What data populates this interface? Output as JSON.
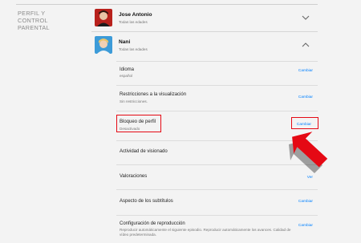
{
  "section_title": "PERFIL Y CONTROL PARENTAL",
  "profiles": [
    {
      "name": "Jose Antonio",
      "maturity": "Todas las edades",
      "expanded": false
    },
    {
      "name": "Nani",
      "maturity": "Todas las edades",
      "expanded": true
    }
  ],
  "settings": [
    {
      "title": "Idioma",
      "description": "español",
      "action": "Cambiar"
    },
    {
      "title": "Restricciones a la visualización",
      "description": "Sin restricciones.",
      "action": "Cambiar"
    },
    {
      "title": "Bloqueo de perfil",
      "description": "Desactivado",
      "action": "Cambiar",
      "highlighted": true
    },
    {
      "title": "Actividad de visionado",
      "description": "",
      "action": "Ver"
    },
    {
      "title": "Valoraciones",
      "description": "",
      "action": "Ver"
    },
    {
      "title": "Aspecto de los subtítulos",
      "description": "",
      "action": "Cambiar"
    },
    {
      "title": "Configuración de reproducción",
      "description": "Reproducir automáticamente el siguiente episodio. Reproducir automáticamente los avances. Calidad de vídeo predeterminada.",
      "action": "Cambiar"
    }
  ],
  "colors": {
    "highlight": "#e50914",
    "link": "#0080ff",
    "background": "#f3f3f3"
  },
  "icons": {
    "collapsed": "chevron-down-icon",
    "expanded": "chevron-up-icon",
    "annotation": "red-arrow-icon"
  }
}
